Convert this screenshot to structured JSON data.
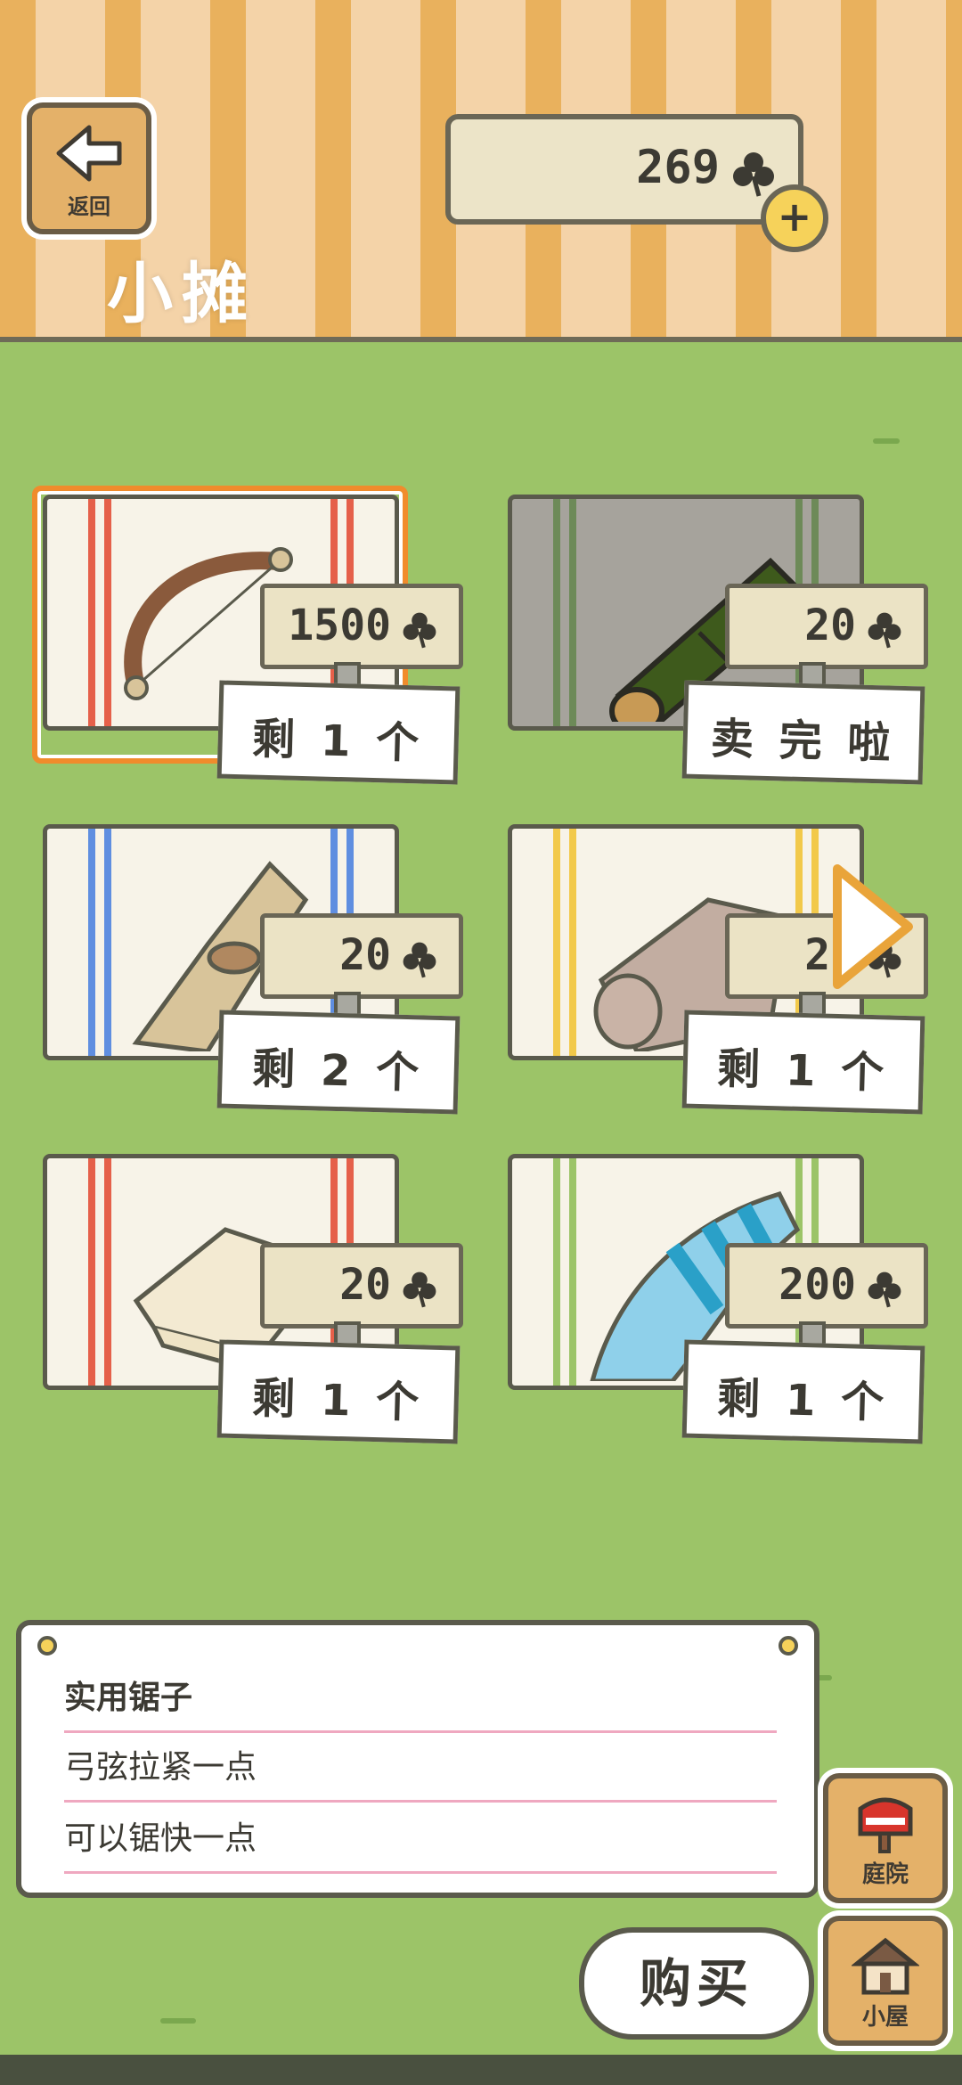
{
  "header": {
    "back_label": "返回",
    "currency_amount": "269",
    "title": "小摊"
  },
  "items": [
    {
      "name": "bow",
      "price": "1500",
      "stock": "剩 1 个",
      "selected": true
    },
    {
      "name": "bamboo",
      "price": "20",
      "stock": "卖 完 啦",
      "selected": false
    },
    {
      "name": "bundle",
      "price": "20",
      "stock": "剩 2 个",
      "selected": false
    },
    {
      "name": "roll",
      "price": "20",
      "stock": "剩 1 个",
      "selected": false
    },
    {
      "name": "cloth",
      "price": "20",
      "stock": "剩 1 个",
      "selected": false
    },
    {
      "name": "shell",
      "price": "200",
      "stock": "剩 1 个",
      "selected": false
    }
  ],
  "description": {
    "title": "实用锯子",
    "line1": "弓弦拉紧一点",
    "line2": "可以锯快一点"
  },
  "buttons": {
    "buy": "购买",
    "yard": "庭院",
    "house": "小屋"
  },
  "colors": {
    "grass": "#9cc468",
    "stripe_orange": "#e9b15d",
    "selected_outline": "#f08c2c",
    "clover_currency": "#3c3a33"
  }
}
